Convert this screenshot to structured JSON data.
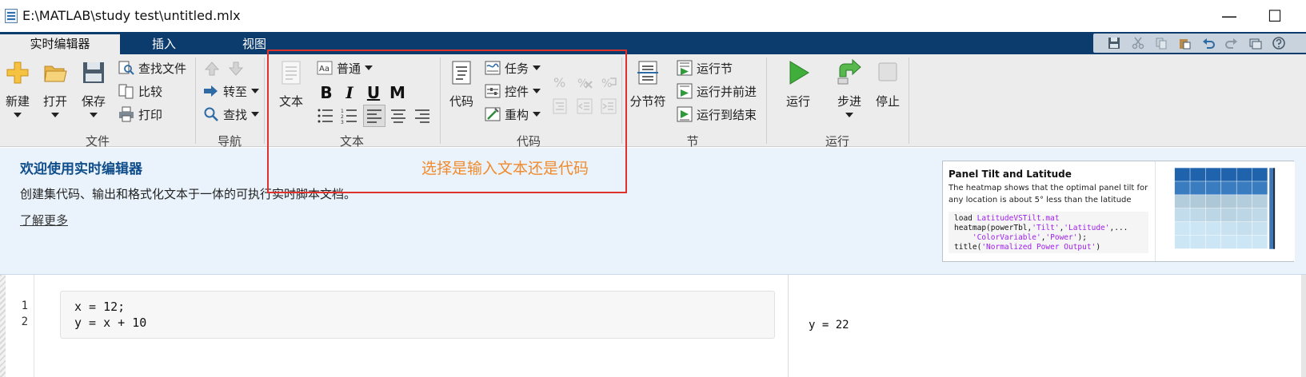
{
  "window": {
    "title": "E:\\MATLAB\\study test\\untitled.mlx",
    "minimize": "—",
    "maximize": "☐"
  },
  "tabs": [
    {
      "label": "实时编辑器",
      "active": true
    },
    {
      "label": "插入",
      "active": false
    },
    {
      "label": "视图",
      "active": false
    }
  ],
  "ribbon": {
    "file": {
      "group_label": "文件",
      "new": "新建",
      "open": "打开",
      "save": "保存",
      "find_files": "查找文件",
      "compare": "比较",
      "print": "打印"
    },
    "navigate": {
      "group_label": "导航",
      "goto": "转至",
      "find": "查找"
    },
    "text": {
      "group_label": "文本",
      "text_button": "文本",
      "style_select": "普通",
      "bold": "B",
      "italic": "I",
      "underline": "U",
      "monospace": "M"
    },
    "code": {
      "group_label": "代码",
      "code_button": "代码",
      "task": "任务",
      "control": "控件",
      "refactor": "重构"
    },
    "section": {
      "group_label": "节",
      "section_break": "分节符",
      "run_section": "运行节",
      "run_and_advance": "运行并前进",
      "run_to_end": "运行到结束"
    },
    "run": {
      "group_label": "运行",
      "run": "运行",
      "step": "步进",
      "stop": "停止"
    }
  },
  "annotation": {
    "text": "选择是输入文本还是代码",
    "color": "#f08a2c",
    "box_color": "#e0322c"
  },
  "banner": {
    "heading": "欢迎使用实时编辑器",
    "description": "创建集代码、输出和格式化文本于一体的可执行实时脚本文档。",
    "learn_more": "了解更多",
    "card": {
      "title": "Panel Tilt and Latitude",
      "description": "The heatmap shows that the optimal panel tilt for any location is about 5° less than the latitude",
      "code": {
        "l1a": "load ",
        "l1b": "LatitudeVSTilt.mat",
        "l2a": "heatmap(powerTbl,",
        "l2b": "'Tilt'",
        "l2c": ",",
        "l2d": "'Latitude'",
        "l2e": ",...",
        "l3a": "    ",
        "l3b": "'ColorVariable'",
        "l3c": ",",
        "l3d": "'Power'",
        "l3e": ");",
        "l4a": "title(",
        "l4b": "'Normalized Power Output'",
        "l4c": ")"
      }
    }
  },
  "editor": {
    "line_numbers": [
      "1",
      "2"
    ],
    "code_lines": [
      "x = 12;",
      "y = x + 10"
    ],
    "output": "y = 22"
  },
  "colors": {
    "tab_strip": "#0c3c6d",
    "ribbon_bg": "#ececec",
    "banner_bg": "#eaf3fc",
    "heading": "#0f4d8a",
    "string": "#a020f0"
  }
}
